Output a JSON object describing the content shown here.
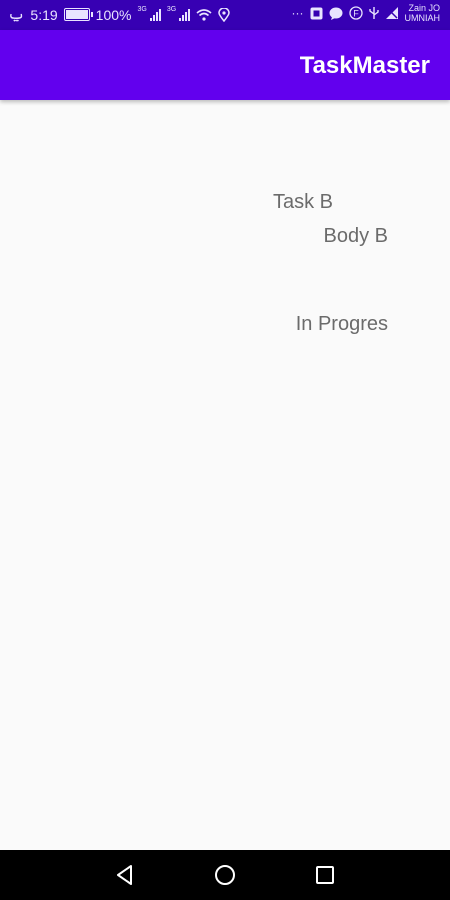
{
  "status_bar": {
    "left_icon": "ݐ",
    "time": "5:19",
    "battery_pct": "100%",
    "net1": "3G",
    "net2": "3G",
    "carrier_line1": "Zain JO",
    "carrier_line2": "UMNIAH",
    "icons": [
      "battery-icon",
      "signal-icon",
      "wifi-icon",
      "location-icon",
      "more-icon",
      "app-icon",
      "chat-icon",
      "f-icon",
      "usb-icon",
      "no-sim-icon"
    ]
  },
  "app_bar": {
    "title": "TaskMaster"
  },
  "task": {
    "title": "Task B",
    "body": "Body B",
    "state": "In Progres"
  },
  "nav": {
    "icons": [
      "back-icon",
      "home-icon",
      "recent-apps-icon"
    ]
  },
  "colors": {
    "status_bar": "#3700b3",
    "app_bar": "#6200ee",
    "background": "#fafafa",
    "text": "#6b6b6b"
  }
}
